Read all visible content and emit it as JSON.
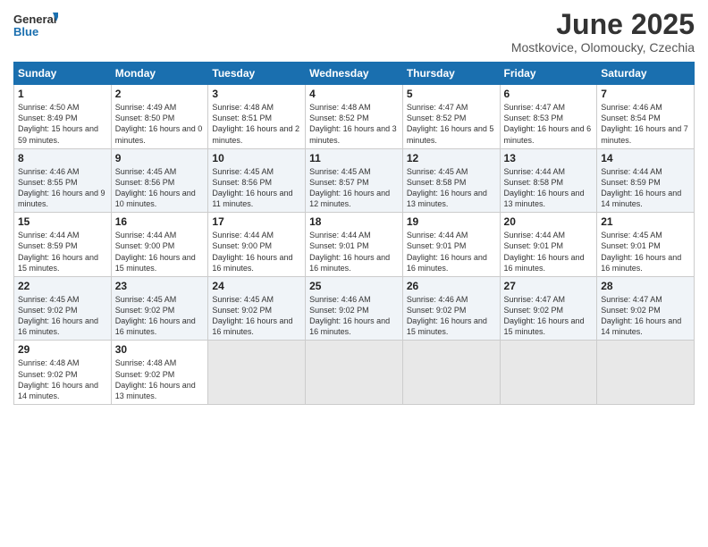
{
  "logo": {
    "line1": "General",
    "line2": "Blue"
  },
  "title": "June 2025",
  "subtitle": "Mostkovice, Olomoucky, Czechia",
  "header_days": [
    "Sunday",
    "Monday",
    "Tuesday",
    "Wednesday",
    "Thursday",
    "Friday",
    "Saturday"
  ],
  "weeks": [
    [
      {
        "day": "1",
        "detail": "Sunrise: 4:50 AM\nSunset: 8:49 PM\nDaylight: 15 hours and 59 minutes."
      },
      {
        "day": "2",
        "detail": "Sunrise: 4:49 AM\nSunset: 8:50 PM\nDaylight: 16 hours and 0 minutes."
      },
      {
        "day": "3",
        "detail": "Sunrise: 4:48 AM\nSunset: 8:51 PM\nDaylight: 16 hours and 2 minutes."
      },
      {
        "day": "4",
        "detail": "Sunrise: 4:48 AM\nSunset: 8:52 PM\nDaylight: 16 hours and 3 minutes."
      },
      {
        "day": "5",
        "detail": "Sunrise: 4:47 AM\nSunset: 8:52 PM\nDaylight: 16 hours and 5 minutes."
      },
      {
        "day": "6",
        "detail": "Sunrise: 4:47 AM\nSunset: 8:53 PM\nDaylight: 16 hours and 6 minutes."
      },
      {
        "day": "7",
        "detail": "Sunrise: 4:46 AM\nSunset: 8:54 PM\nDaylight: 16 hours and 7 minutes."
      }
    ],
    [
      {
        "day": "8",
        "detail": "Sunrise: 4:46 AM\nSunset: 8:55 PM\nDaylight: 16 hours and 9 minutes."
      },
      {
        "day": "9",
        "detail": "Sunrise: 4:45 AM\nSunset: 8:56 PM\nDaylight: 16 hours and 10 minutes."
      },
      {
        "day": "10",
        "detail": "Sunrise: 4:45 AM\nSunset: 8:56 PM\nDaylight: 16 hours and 11 minutes."
      },
      {
        "day": "11",
        "detail": "Sunrise: 4:45 AM\nSunset: 8:57 PM\nDaylight: 16 hours and 12 minutes."
      },
      {
        "day": "12",
        "detail": "Sunrise: 4:45 AM\nSunset: 8:58 PM\nDaylight: 16 hours and 13 minutes."
      },
      {
        "day": "13",
        "detail": "Sunrise: 4:44 AM\nSunset: 8:58 PM\nDaylight: 16 hours and 13 minutes."
      },
      {
        "day": "14",
        "detail": "Sunrise: 4:44 AM\nSunset: 8:59 PM\nDaylight: 16 hours and 14 minutes."
      }
    ],
    [
      {
        "day": "15",
        "detail": "Sunrise: 4:44 AM\nSunset: 8:59 PM\nDaylight: 16 hours and 15 minutes."
      },
      {
        "day": "16",
        "detail": "Sunrise: 4:44 AM\nSunset: 9:00 PM\nDaylight: 16 hours and 15 minutes."
      },
      {
        "day": "17",
        "detail": "Sunrise: 4:44 AM\nSunset: 9:00 PM\nDaylight: 16 hours and 16 minutes."
      },
      {
        "day": "18",
        "detail": "Sunrise: 4:44 AM\nSunset: 9:01 PM\nDaylight: 16 hours and 16 minutes."
      },
      {
        "day": "19",
        "detail": "Sunrise: 4:44 AM\nSunset: 9:01 PM\nDaylight: 16 hours and 16 minutes."
      },
      {
        "day": "20",
        "detail": "Sunrise: 4:44 AM\nSunset: 9:01 PM\nDaylight: 16 hours and 16 minutes."
      },
      {
        "day": "21",
        "detail": "Sunrise: 4:45 AM\nSunset: 9:01 PM\nDaylight: 16 hours and 16 minutes."
      }
    ],
    [
      {
        "day": "22",
        "detail": "Sunrise: 4:45 AM\nSunset: 9:02 PM\nDaylight: 16 hours and 16 minutes."
      },
      {
        "day": "23",
        "detail": "Sunrise: 4:45 AM\nSunset: 9:02 PM\nDaylight: 16 hours and 16 minutes."
      },
      {
        "day": "24",
        "detail": "Sunrise: 4:45 AM\nSunset: 9:02 PM\nDaylight: 16 hours and 16 minutes."
      },
      {
        "day": "25",
        "detail": "Sunrise: 4:46 AM\nSunset: 9:02 PM\nDaylight: 16 hours and 16 minutes."
      },
      {
        "day": "26",
        "detail": "Sunrise: 4:46 AM\nSunset: 9:02 PM\nDaylight: 16 hours and 15 minutes."
      },
      {
        "day": "27",
        "detail": "Sunrise: 4:47 AM\nSunset: 9:02 PM\nDaylight: 16 hours and 15 minutes."
      },
      {
        "day": "28",
        "detail": "Sunrise: 4:47 AM\nSunset: 9:02 PM\nDaylight: 16 hours and 14 minutes."
      }
    ],
    [
      {
        "day": "29",
        "detail": "Sunrise: 4:48 AM\nSunset: 9:02 PM\nDaylight: 16 hours and 14 minutes."
      },
      {
        "day": "30",
        "detail": "Sunrise: 4:48 AM\nSunset: 9:02 PM\nDaylight: 16 hours and 13 minutes."
      },
      {
        "day": "",
        "detail": ""
      },
      {
        "day": "",
        "detail": ""
      },
      {
        "day": "",
        "detail": ""
      },
      {
        "day": "",
        "detail": ""
      },
      {
        "day": "",
        "detail": ""
      }
    ]
  ]
}
